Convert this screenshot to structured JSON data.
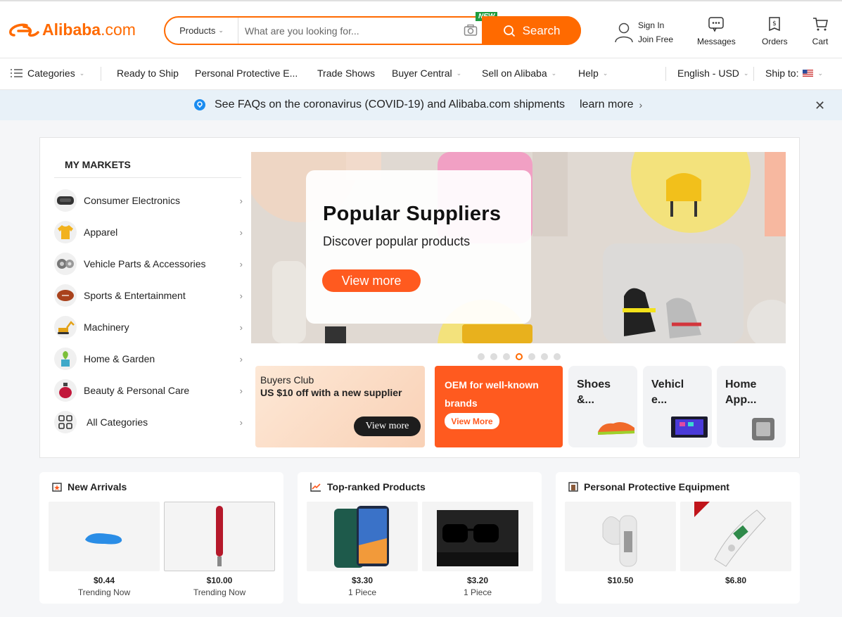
{
  "header": {
    "logo_text": "Alibaba",
    "logo_suffix": ".com",
    "search": {
      "category": "Products",
      "placeholder": "What are you looking for...",
      "button_label": "Search",
      "new_badge": "NEW"
    },
    "sign_in": "Sign In",
    "join_free": "Join Free",
    "messages": "Messages",
    "orders": "Orders",
    "cart": "Cart"
  },
  "nav": {
    "categories": "Categories",
    "items": [
      "Ready to Ship",
      "Personal Protective E...",
      "Trade Shows",
      "Buyer Central",
      "Sell on Alibaba",
      "Help"
    ],
    "language": "English - USD",
    "ship_to": "Ship to:"
  },
  "covid_banner": {
    "text": "See FAQs on the coronavirus (COVID-19) and Alibaba.com shipments",
    "link": "learn more"
  },
  "my_markets": {
    "title": "MY MARKETS",
    "items": [
      {
        "label": "Consumer Electronics"
      },
      {
        "label": "Apparel"
      },
      {
        "label": "Vehicle Parts & Accessories"
      },
      {
        "label": "Sports & Entertainment"
      },
      {
        "label": "Machinery"
      },
      {
        "label": "Home & Garden"
      },
      {
        "label": "Beauty & Personal Care"
      },
      {
        "label": "All Categories"
      }
    ]
  },
  "hero": {
    "title": "Popular Suppliers",
    "subtitle": "Discover popular products",
    "button": "View more",
    "slide_count": 7,
    "active_slide": 4
  },
  "promos": {
    "buyers_club": {
      "title": "Buyers Club",
      "text": "US $10 off with a new supplier",
      "button": "View more"
    },
    "oem": {
      "line1": "OEM for well-known",
      "line2": "brands",
      "button": "View More"
    },
    "shoes": {
      "line1": "Shoes",
      "line2": "&..."
    },
    "vehicle": {
      "line1": "Vehicl",
      "line2": "e..."
    },
    "home": {
      "line1": "Home",
      "line2": "App..."
    }
  },
  "cards": {
    "new_arrivals": {
      "title": "New Arrivals",
      "products": [
        {
          "price": "$0.44",
          "sub": "Trending Now"
        },
        {
          "price": "$10.00",
          "sub": "Trending Now"
        }
      ]
    },
    "top_ranked": {
      "title": "Top-ranked Products",
      "products": [
        {
          "price": "$3.30",
          "sub": "1 Piece"
        },
        {
          "price": "$3.20",
          "sub": "1 Piece"
        }
      ]
    },
    "ppe": {
      "title": "Personal Protective Equipment",
      "products": [
        {
          "price": "$10.50",
          "sub": ""
        },
        {
          "price": "$6.80",
          "sub": ""
        }
      ]
    }
  },
  "colors": {
    "brand": "#ff6a00",
    "accent": "#ff5a1f",
    "banner_bg": "#e8f1f8"
  }
}
